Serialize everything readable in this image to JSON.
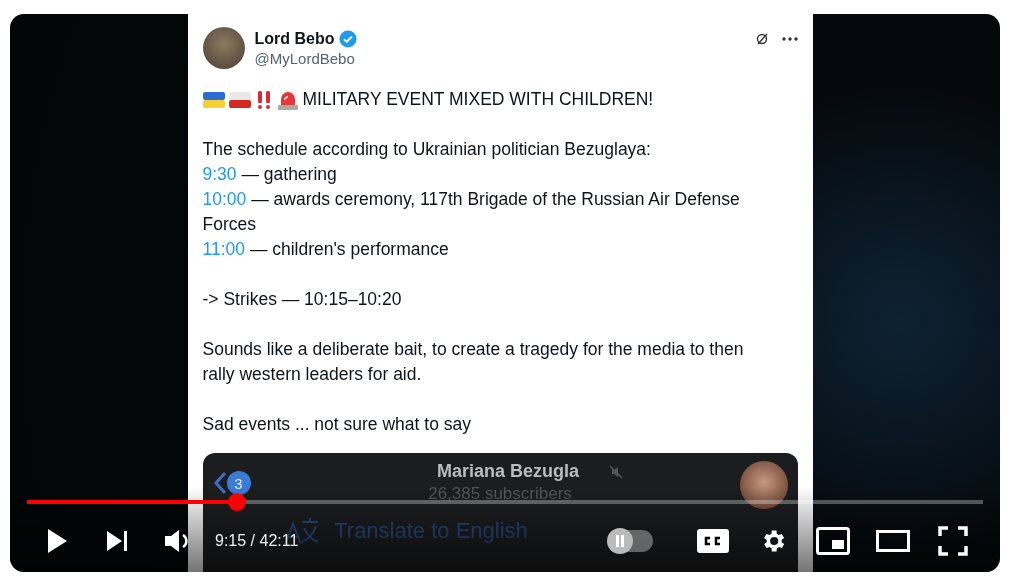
{
  "video": {
    "tweet": {
      "name": "Lord Bebo",
      "verified": true,
      "handle": "@MyLordBebo",
      "headline": "MILITARY EVENT MIXED WITH CHILDREN!",
      "intro": "The schedule according to Ukrainian politician Bezuglaya:",
      "schedule": [
        {
          "time": "9:30",
          "text": "— gathering"
        },
        {
          "time": "10:00",
          "text": "— awards ceremony, 117th Brigade of the Russian Air Defense Forces"
        },
        {
          "time": "11:00",
          "text": "— children's performance"
        }
      ],
      "paragraphs": [
        "-> Strikes — 10:15–10:20",
        "Sounds like a deliberate bait, to create a tragedy for the media to then rally western leaders for aid.",
        "Sad events ... not sure what to say"
      ]
    },
    "channel_card": {
      "badge": "3",
      "name": "Mariana Bezugla",
      "muted": true,
      "subscribers": "26,385 subscribers",
      "translate": "Translate to English"
    }
  },
  "player": {
    "progress": {
      "level": 0.22
    },
    "time": "9:15 / 42:11",
    "autoplay": {
      "on": false
    }
  }
}
